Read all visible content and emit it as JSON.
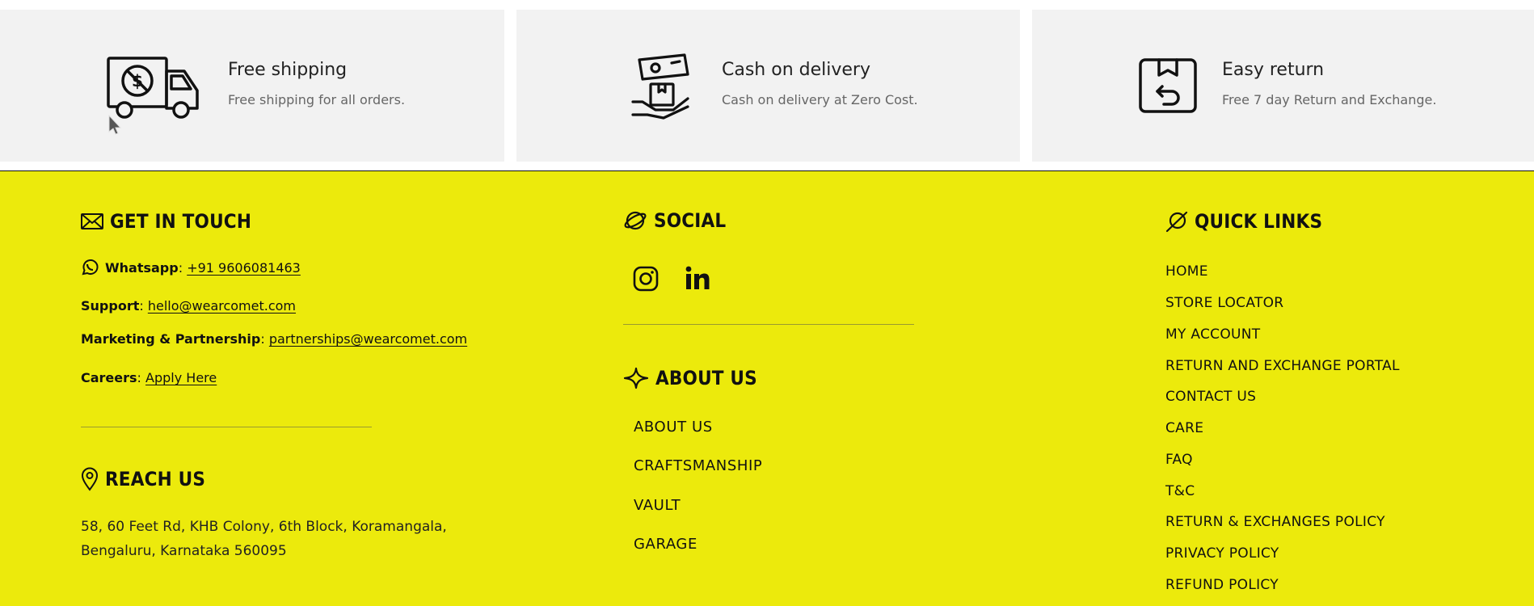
{
  "features": [
    {
      "title": "Free shipping",
      "desc": "Free shipping for all orders.",
      "icon": "delivery-truck-icon"
    },
    {
      "title": "Cash on delivery",
      "desc": "Cash on delivery at Zero Cost.",
      "icon": "cash-in-hand-icon"
    },
    {
      "title": "Easy return",
      "desc": "Free 7 day Return and Exchange.",
      "icon": "return-box-icon"
    }
  ],
  "footer": {
    "bg_color": "#ecea0c",
    "get_in_touch": {
      "heading": "GET IN TOUCH",
      "whatsapp_label": "Whatsapp",
      "whatsapp_value": "+91 9606081463",
      "support_label": "Support",
      "support_value": "hello@wearcomet.com",
      "marketing_label": "Marketing & Partnership",
      "marketing_value": "partnerships@wearcomet.com",
      "careers_label": "Careers",
      "careers_value": "Apply Here",
      "separator": ":"
    },
    "reach_us": {
      "heading": "REACH US",
      "address_line1": "58, 60 Feet Rd, KHB Colony, 6th Block, Koramangala,",
      "address_line2": "Bengaluru, Karnataka 560095"
    },
    "social": {
      "heading": "SOCIAL",
      "icons": [
        "instagram-icon",
        "linkedin-icon"
      ]
    },
    "about_us": {
      "heading": "ABOUT US",
      "links": [
        "ABOUT US",
        "CRAFTSMANSHIP",
        "VAULT",
        "GARAGE"
      ]
    },
    "quick_links": {
      "heading": "QUICK LINKS",
      "links": [
        "HOME",
        "STORE LOCATOR",
        "MY ACCOUNT",
        "RETURN AND EXCHANGE PORTAL",
        "CONTACT US",
        "CARE",
        "FAQ",
        "T&C",
        "RETURN & EXCHANGES POLICY",
        "PRIVACY POLICY",
        "REFUND POLICY"
      ]
    }
  }
}
